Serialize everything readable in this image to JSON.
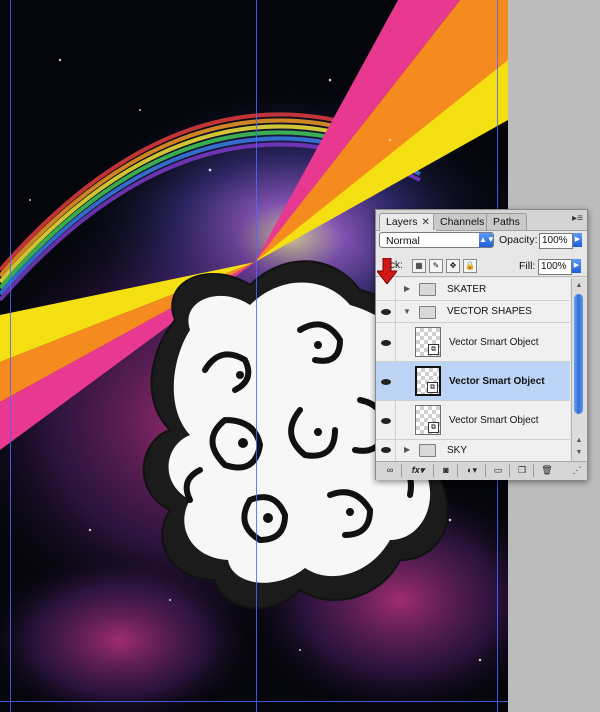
{
  "panel": {
    "tabs": [
      {
        "label": "Layers",
        "close": "✕",
        "active": true
      },
      {
        "label": "Channels",
        "active": false
      },
      {
        "label": "Paths",
        "active": false
      }
    ],
    "menu_icon": "panel-menu-icon",
    "blend_mode": "Normal",
    "opacity_label": "Opacity:",
    "opacity_value": "100%",
    "lock_label": "ck:",
    "fill_label": "Fill:",
    "fill_value": "100%"
  },
  "layers": [
    {
      "name": "SKATER",
      "type": "group",
      "expanded": false,
      "visible": false
    },
    {
      "name": "VECTOR SHAPES",
      "type": "group",
      "expanded": true,
      "visible": true
    },
    {
      "name": "Vector Smart Object",
      "type": "smart-object",
      "visible": true,
      "selected": false
    },
    {
      "name": "Vector Smart Object",
      "type": "smart-object",
      "visible": true,
      "selected": true
    },
    {
      "name": "Vector Smart Object",
      "type": "smart-object",
      "visible": true,
      "selected": false
    },
    {
      "name": "SKY",
      "type": "group",
      "expanded": false,
      "visible": true
    }
  ],
  "bottom_bar": {
    "fx_label": "fx",
    "icons": [
      "link-icon",
      "fx-icon",
      "mask-icon",
      "adjustment-icon",
      "new-group-icon",
      "new-layer-icon",
      "trash-icon"
    ]
  },
  "colors": {
    "pink": "#e8388f",
    "orange": "#f58a1f",
    "yellow": "#f4df12",
    "guide": "#4b66ff",
    "selection": "#bcd5f7"
  }
}
